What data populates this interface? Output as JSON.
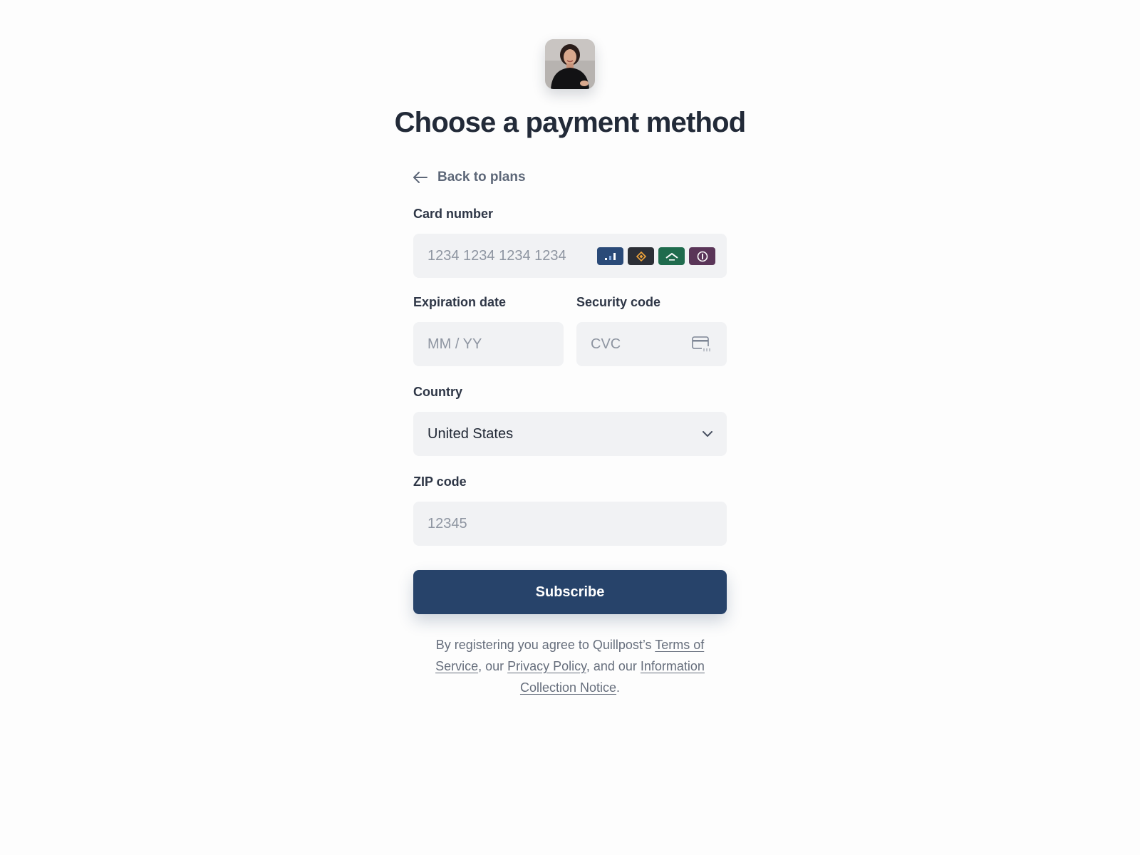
{
  "header": {
    "avatar_alt": "Profile photo",
    "title": "Choose a payment method"
  },
  "nav": {
    "back_label": "Back to plans"
  },
  "form": {
    "card_number": {
      "label": "Card number",
      "placeholder": "1234 1234 1234 1234",
      "brand_icons": [
        "bar-chart-brand-icon",
        "diamond-brand-icon",
        "chevron-brand-icon",
        "circle-brand-icon"
      ],
      "brand_colors": [
        "#2a4a78",
        "#2c2f36",
        "#1f6b4d",
        "#5a3558"
      ]
    },
    "expiration": {
      "label": "Expiration date",
      "placeholder": "MM / YY"
    },
    "security_code": {
      "label": "Security code",
      "placeholder": "CVC",
      "icon": "card-cvc-icon"
    },
    "country": {
      "label": "Country",
      "value": "United States"
    },
    "zip": {
      "label": "ZIP code",
      "placeholder": "12345"
    },
    "submit_label": "Subscribe"
  },
  "legal": {
    "prefix": "By registering you agree to Quillpost’s ",
    "terms_link": "Terms of Service",
    "sep1": ", our ",
    "privacy_link": "Privacy Policy",
    "sep2": ", and our ",
    "notice_link": "Information Collection Notice",
    "suffix": "."
  },
  "colors": {
    "primary": "#27436a",
    "field_bg": "#f1f2f4",
    "title": "#222a38"
  }
}
